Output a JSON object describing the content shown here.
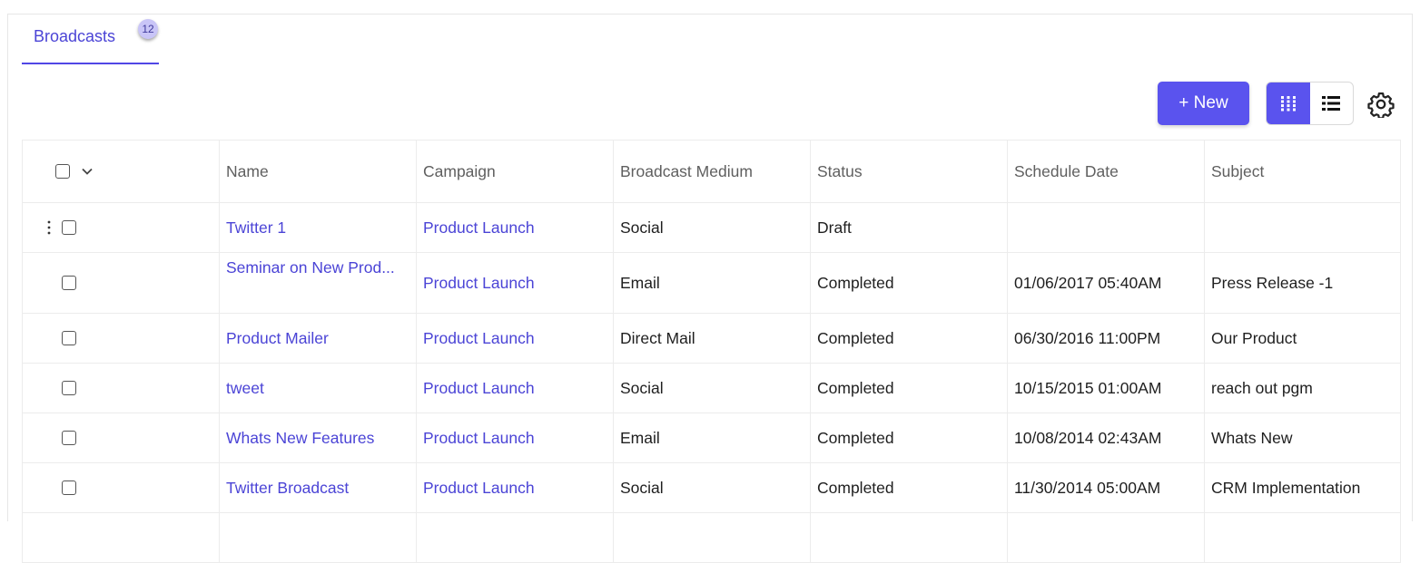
{
  "tabs": [
    {
      "label": "Broadcasts",
      "count": "12"
    }
  ],
  "toolbar": {
    "new_label": "+ New"
  },
  "icons": {
    "grid": "grid-view-icon",
    "list": "list-view-icon",
    "settings": "gear-icon",
    "more": "more-vertical-icon",
    "dropdown": "chevron-down-icon"
  },
  "colors": {
    "accent": "#5a53ee",
    "link": "#4b44d6"
  },
  "table": {
    "columns": [
      "Name",
      "Campaign",
      "Broadcast Medium",
      "Status",
      "Schedule Date",
      "Subject"
    ],
    "rows": [
      {
        "name": "Twitter 1",
        "campaign": "Product Launch",
        "medium": "Social",
        "status": "Draft",
        "date": "",
        "subject": ""
      },
      {
        "name": "Seminar on New Prod...",
        "campaign": "Product Launch",
        "medium": "Email",
        "status": "Completed",
        "date": "01/06/2017 05:40AM",
        "subject": "Press Release -1"
      },
      {
        "name": "Product Mailer",
        "campaign": "Product Launch",
        "medium": "Direct Mail",
        "status": "Completed",
        "date": "06/30/2016 11:00PM",
        "subject": "Our Product"
      },
      {
        "name": "tweet",
        "campaign": "Product Launch",
        "medium": "Social",
        "status": "Completed",
        "date": "10/15/2015 01:00AM",
        "subject": "reach out pgm"
      },
      {
        "name": "Whats New Features",
        "campaign": "Product Launch",
        "medium": "Email",
        "status": "Completed",
        "date": "10/08/2014 02:43AM",
        "subject": "Whats New"
      },
      {
        "name": "Twitter Broadcast",
        "campaign": "Product Launch",
        "medium": "Social",
        "status": "Completed",
        "date": "11/30/2014 05:00AM",
        "subject": "CRM Implementation"
      }
    ]
  }
}
